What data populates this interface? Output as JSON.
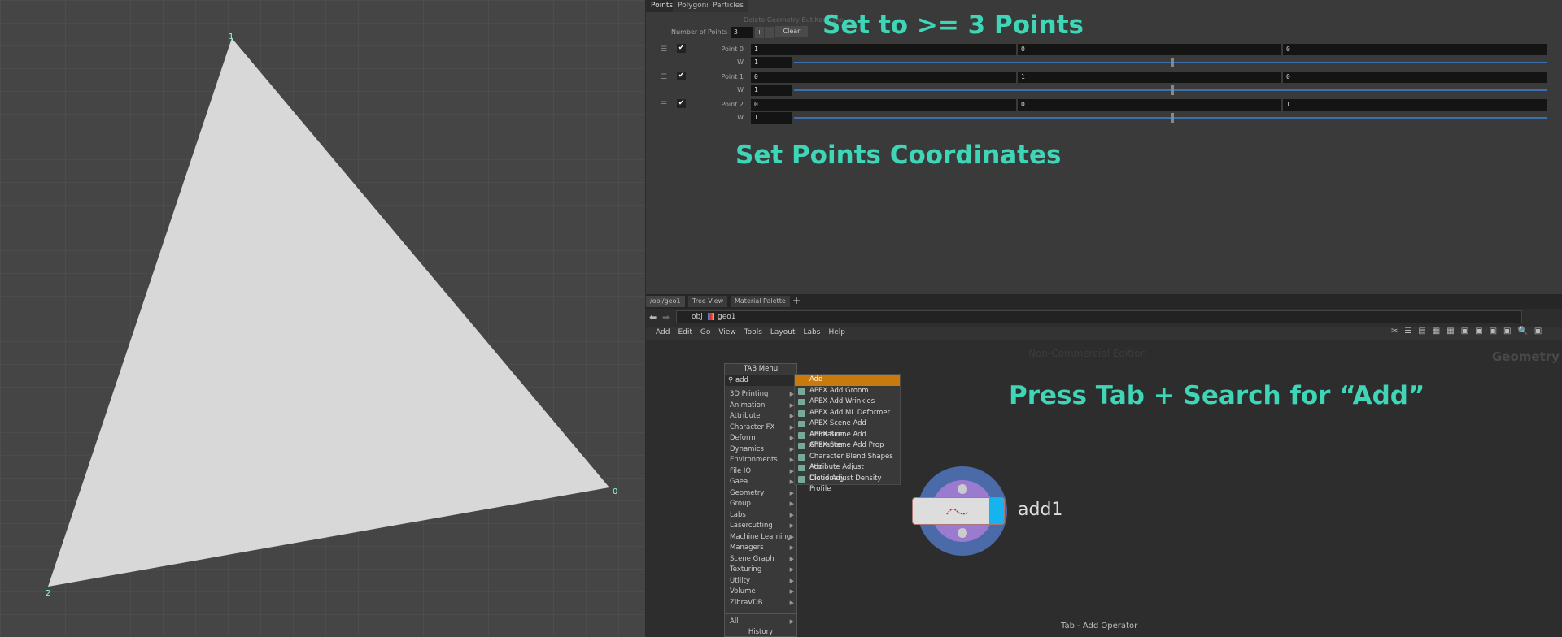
{
  "viewport": {
    "point_labels": [
      "1",
      "0",
      "2"
    ],
    "triangle_color": "#d8d8d8"
  },
  "params": {
    "tabs": [
      "Points",
      "Polygons",
      "Particles"
    ],
    "delete_geometry_label": "Delete Geometry But Keep the ...",
    "number_of_points_label": "Number of Points",
    "number_of_points": "3",
    "plus": "+",
    "minus": "−",
    "clear": "Clear",
    "w_label": "W",
    "points": [
      {
        "label": "Point 0",
        "x": "1",
        "y": "0",
        "z": "0",
        "w": "1",
        "enabled": true
      },
      {
        "label": "Point 1",
        "x": "0",
        "y": "1",
        "z": "0",
        "w": "1",
        "enabled": true
      },
      {
        "label": "Point 2",
        "x": "0",
        "y": "0",
        "z": "1",
        "w": "1",
        "enabled": true
      }
    ],
    "w_slider_fraction": 0.5
  },
  "annotations": {
    "set_points": "Set to >= 3 Points",
    "set_coords": "Set Points Coordinates",
    "press_tab": "Press Tab + Search for “Add”",
    "accent": "#3ed6b6"
  },
  "network": {
    "tabs": [
      "/obj/geo1",
      "Tree View",
      "Material Palette"
    ],
    "path": [
      "obj",
      "geo1"
    ],
    "menu": [
      "Add",
      "Edit",
      "Go",
      "View",
      "Tools",
      "Layout",
      "Labs",
      "Help"
    ],
    "watermark": "Non-Commercial Edition",
    "context": "Geometry",
    "status": "Tab - Add Operator",
    "node": {
      "name": "add1"
    }
  },
  "tab_menu": {
    "title": "TAB Menu",
    "search": "add",
    "categories": [
      "3D Printing",
      "Animation",
      "Attribute",
      "Character FX",
      "Deform",
      "Dynamics",
      "Environments",
      "File IO",
      "Gaea",
      "Geometry",
      "Group",
      "Labs",
      "Lasercutting",
      "Machine Learning",
      "Managers",
      "Scene Graph",
      "Texturing",
      "Utility",
      "Volume",
      "ZibraVDB"
    ],
    "all": "All",
    "history": "History",
    "results": [
      "Add",
      "APEX Add Groom",
      "APEX Add Wrinkles",
      "APEX Add ML Deformer",
      "APEX Scene Add Animation",
      "APEX Scene Add Character",
      "APEX Scene Add Prop",
      "Character Blend Shapes Add",
      "Attribute Adjust Dictionary",
      "Cloud Adjust Density Profile"
    ],
    "highlight_color": "#c87a0c"
  }
}
